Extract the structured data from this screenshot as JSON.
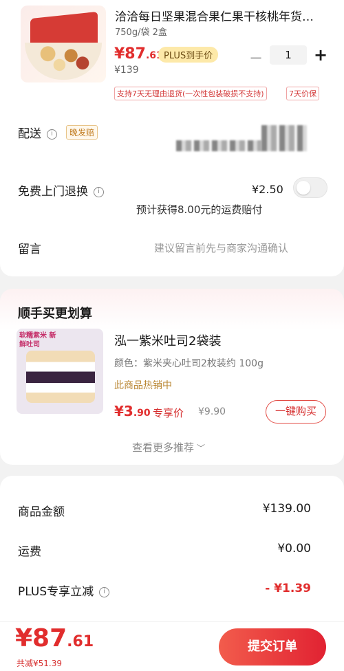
{
  "product": {
    "title": "洽洽每日坚果混合果仁果干核桃年货…",
    "spec": "750g/袋 2盒",
    "price_int": "¥87",
    "price_dec": ".61",
    "plus_badge": "PLUS到手价",
    "original_price": "¥139",
    "quantity": "1",
    "minus": "−",
    "plus": "+",
    "tags": [
      "支持7天无理由退货(一次性包装破损不支持)",
      "7天价保"
    ]
  },
  "delivery": {
    "label": "配送",
    "info": "i",
    "badge": "晚发赔"
  },
  "return_service": {
    "label": "免费上门退换",
    "info": "i",
    "price": "¥2.50",
    "hint": "预计获得8.00元的运费赔付"
  },
  "message": {
    "label": "留言",
    "placeholder": "建议留言前先与商家沟通确认"
  },
  "addon": {
    "section_title": "顺手买更划算",
    "image_label": "软糯紫米 新鲜吐司",
    "title": "泓一紫米吐司2袋装",
    "spec": "颜色：紫米夹心吐司2枚装约 100g",
    "hot": "此商品热销中",
    "price_int": "¥3",
    "price_dec": ".90",
    "exclusive": "专享价",
    "original": "¥9.90",
    "buy_button": "一键购买",
    "more": "查看更多推荐",
    "more_icon": "﹀"
  },
  "summary": {
    "goods_label": "商品金额",
    "goods_value": "¥139.00",
    "shipping_label": "运费",
    "shipping_value": "¥0.00",
    "plus_label": "PLUS专享立减",
    "plus_info": "i",
    "plus_value": "- ¥1.39"
  },
  "footer": {
    "total_int": "¥87",
    "total_dec": ".61",
    "saved": "共减¥51.39",
    "submit": "提交订单"
  },
  "colors": {
    "accent": "#e12d2d",
    "plus_badge_bg": "#fde9a9"
  }
}
